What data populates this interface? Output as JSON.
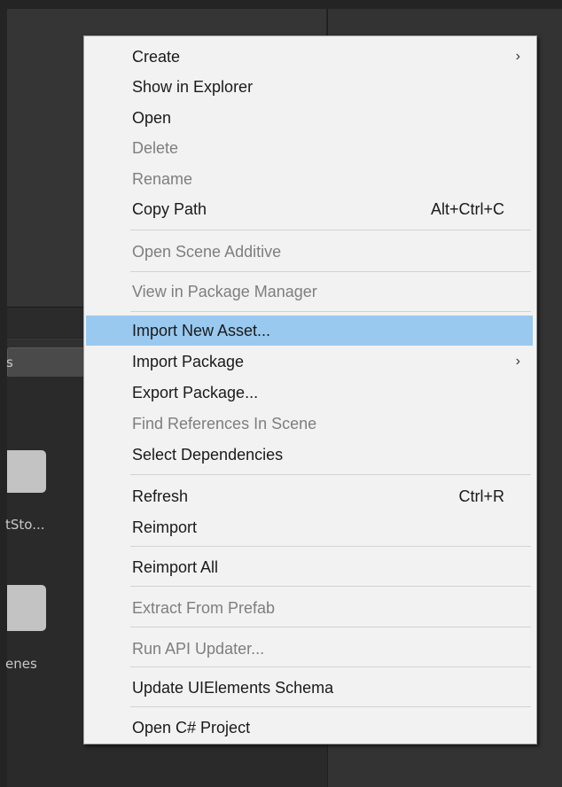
{
  "background": {
    "folders": [
      {
        "label": "tSto..."
      },
      {
        "label": "enes"
      }
    ],
    "tab_label": "s"
  },
  "menu": {
    "items": [
      {
        "label": "Create",
        "shortcut": "",
        "submenu": true,
        "enabled": true
      },
      {
        "label": "Show in Explorer",
        "shortcut": "",
        "submenu": false,
        "enabled": true
      },
      {
        "label": "Open",
        "shortcut": "",
        "submenu": false,
        "enabled": true
      },
      {
        "label": "Delete",
        "shortcut": "",
        "submenu": false,
        "enabled": false
      },
      {
        "label": "Rename",
        "shortcut": "",
        "submenu": false,
        "enabled": false
      },
      {
        "label": "Copy Path",
        "shortcut": "Alt+Ctrl+C",
        "submenu": false,
        "enabled": true
      },
      {
        "label": "Open Scene Additive",
        "shortcut": "",
        "submenu": false,
        "enabled": false
      },
      {
        "label": "View in Package Manager",
        "shortcut": "",
        "submenu": false,
        "enabled": false
      },
      {
        "label": "Import New Asset...",
        "shortcut": "",
        "submenu": false,
        "enabled": true,
        "highlighted": true
      },
      {
        "label": "Import Package",
        "shortcut": "",
        "submenu": true,
        "enabled": true
      },
      {
        "label": "Export Package...",
        "shortcut": "",
        "submenu": false,
        "enabled": true
      },
      {
        "label": "Find References In Scene",
        "shortcut": "",
        "submenu": false,
        "enabled": false
      },
      {
        "label": "Select Dependencies",
        "shortcut": "",
        "submenu": false,
        "enabled": true
      },
      {
        "label": "Refresh",
        "shortcut": "Ctrl+R",
        "submenu": false,
        "enabled": true
      },
      {
        "label": "Reimport",
        "shortcut": "",
        "submenu": false,
        "enabled": true
      },
      {
        "label": "Reimport All",
        "shortcut": "",
        "submenu": false,
        "enabled": true
      },
      {
        "label": "Extract From Prefab",
        "shortcut": "",
        "submenu": false,
        "enabled": false
      },
      {
        "label": "Run API Updater...",
        "shortcut": "",
        "submenu": false,
        "enabled": false
      },
      {
        "label": "Update UIElements Schema",
        "shortcut": "",
        "submenu": false,
        "enabled": true
      },
      {
        "label": "Open C# Project",
        "shortcut": "",
        "submenu": false,
        "enabled": true
      }
    ],
    "submenu_arrow": "›",
    "highlight_color": "#99c9ef",
    "disabled_color": "#7e7e7e"
  }
}
